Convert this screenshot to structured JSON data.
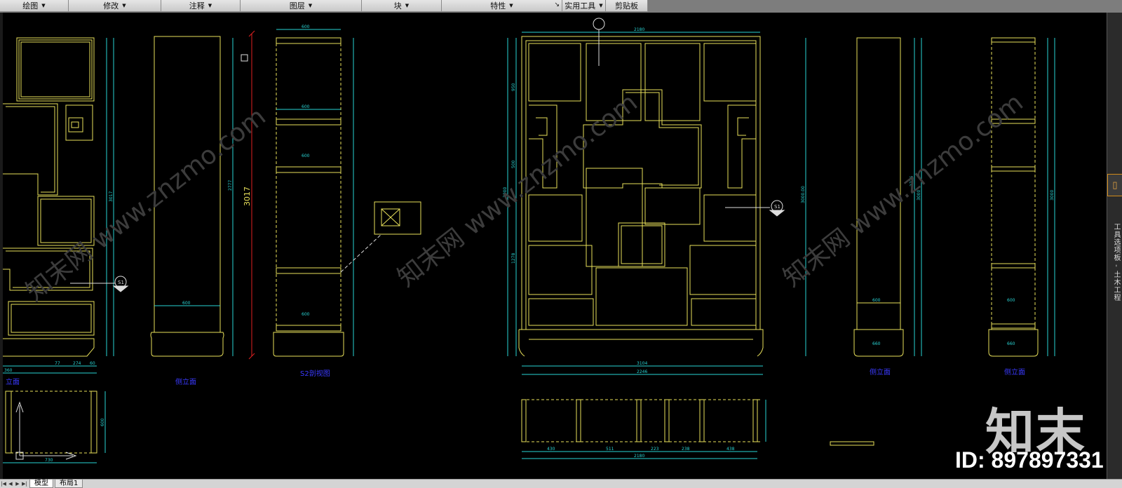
{
  "ribbon": {
    "panels": [
      {
        "label": "绘图",
        "dropdown": true
      },
      {
        "label": "修改",
        "dropdown": true
      },
      {
        "label": "注释",
        "dropdown": true
      },
      {
        "label": "图层",
        "dropdown": true
      },
      {
        "label": "块",
        "dropdown": true
      },
      {
        "label": "特性",
        "dropdown": true
      },
      {
        "label": "实用工具",
        "dropdown": true
      },
      {
        "label": "剪贴板",
        "dropdown": false
      }
    ]
  },
  "drawing": {
    "labels": {
      "side_elevation_1": "侧立面",
      "s2_profile": "S2剖视图",
      "side_elevation_2": "侧立面",
      "side_elevation_3": "侧立面",
      "left_view_fragment": "立面",
      "height_red": "3017"
    },
    "dims": {
      "d3017": "3017",
      "d2777": "2777",
      "d600a": "600",
      "d600b": "600",
      "d600c": "600",
      "d600d": "600",
      "d600e": "600",
      "d2180": "2180",
      "d3000": "3000",
      "d3000b": "3000.00",
      "d950": "950",
      "d500": "500",
      "d1278": "1278",
      "d3104": "3104",
      "d2246": "2246",
      "d2726": "2726",
      "d3000c": "3000",
      "d600f": "600",
      "d660": "660",
      "d3000d": "3000",
      "d600g": "600",
      "d660b": "660",
      "d77": "77",
      "d274": "274",
      "d60a": "60",
      "d360": "360",
      "d730": "730",
      "d2180b": "2180",
      "d511": "511",
      "d223": "223",
      "d238": "238",
      "d438": "438",
      "d430": "430",
      "d600h": "600"
    },
    "section_marks": {
      "s1_left": "S1",
      "s1_right": "S1"
    }
  },
  "palette": {
    "title": "工具选项板 - 土木工程"
  },
  "tabs": {
    "items": [
      {
        "label": "模型",
        "active": true
      },
      {
        "label": "布局1",
        "active": false
      }
    ]
  },
  "watermark": {
    "logo_text": "知末",
    "id_text": "ID: 897897331",
    "diagonal_text": "知末网 www.znzmo.com"
  },
  "colors": {
    "cad_yellow": "#e8e05a",
    "cad_cyan": "#29d4d4",
    "cad_blue": "#3a3aff",
    "cad_red": "#e02020",
    "ribbon_bg": "#d9d9d9"
  }
}
